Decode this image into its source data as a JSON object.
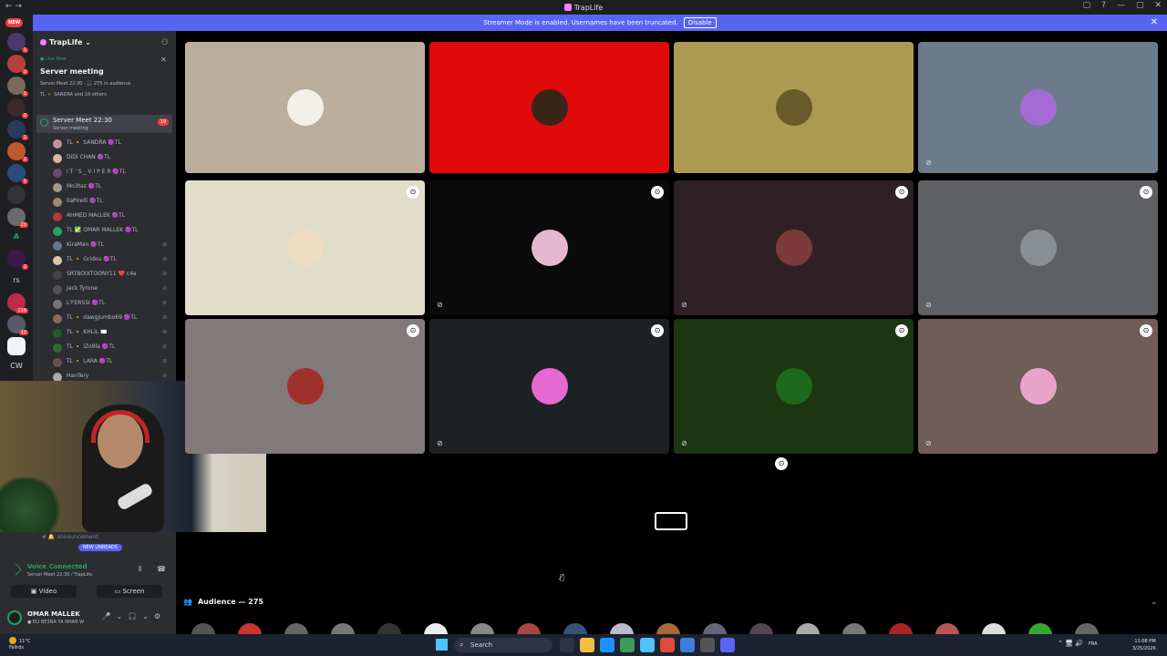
{
  "window": {
    "title": "TrapLife",
    "nav": "← →",
    "controls": [
      "▢",
      "?",
      "—",
      "▢",
      "✕"
    ]
  },
  "banner": {
    "text": "Streamer Mode is enabled. Usernames have been truncated.",
    "disable_label": "Disable",
    "close": "✕"
  },
  "rail": {
    "new_label": "NEW",
    "text_servers": [
      "A",
      "rs",
      "CW"
    ],
    "badges": [
      "1",
      "2",
      "1",
      "2",
      "1",
      "2",
      "1",
      "21",
      "2",
      "116",
      "12"
    ]
  },
  "sidebar": {
    "server_name": "TrapLife",
    "server_chevron": "⌄",
    "live_label": "● Live Now",
    "event_title": "Server meeting",
    "event_meta": "Server Meet 22:30 · 🎧 275 in audience",
    "event_who": "TL 🔸 SANDRA and 16 others",
    "stage_channel": {
      "name": "Server Meet 22:30",
      "topic": "Server meeting",
      "count": "19"
    },
    "members": [
      {
        "name": "TL 🔸 SANDRA  🟣TL",
        "color": "#c98fa0",
        "muted": false
      },
      {
        "name": "DiDi CHAN  🟣TL",
        "color": "#d9b4a8",
        "muted": false
      },
      {
        "name": "I T ' S _ V I P E R  🟣TL",
        "color": "#6a4b6b",
        "muted": false
      },
      {
        "name": "Mo3taz  🟣TL",
        "color": "#a49a8a",
        "muted": false
      },
      {
        "name": "llaPirelli  🟣TL",
        "color": "#9c8b7a",
        "muted": false
      },
      {
        "name": "AHMED MALLEK  🟣TL",
        "color": "#b33a3a",
        "muted": false
      },
      {
        "name": "TL ✅ OMAR MALLEK  🟣TL",
        "color": "#23a55a",
        "muted": false
      },
      {
        "name": "KiraMan  🟣TL",
        "color": "#607a90",
        "muted": true
      },
      {
        "name": "TL 🔸 Gridou  🟣TL",
        "color": "#d9c9a0",
        "muted": true
      },
      {
        "name": "SRTBOIXTOONY11  ❤️ c4a",
        "color": "#444",
        "muted": true
      },
      {
        "name": "Jack Tyrone",
        "color": "#555",
        "muted": true
      },
      {
        "name": "L'FERSSI  🟣TL",
        "color": "#777",
        "muted": true
      },
      {
        "name": "TL 🔸 dawgjumbo69  🟣TL",
        "color": "#8a6a5a",
        "muted": true
      },
      {
        "name": "TL 🔸 KHLIL ✉️",
        "color": "#1f5c2a",
        "muted": true
      },
      {
        "name": "TL 🔸 iZo9la  🟣TL",
        "color": "#2f6b2f",
        "muted": true
      },
      {
        "name": "TL 🔸 LARA  🟣TL",
        "color": "#6b4f4f",
        "muted": true
      },
      {
        "name": "HanTery",
        "color": "#aaa",
        "muted": true
      }
    ]
  },
  "bottom_panel": {
    "channel_announcement": "announcement",
    "new_unreads": "NEW UNREADS",
    "voice_connected": "Voice Connected",
    "voice_sub": "Server Meet 22:30 / TrapLife",
    "video_label": "Video",
    "screen_label": "Screen",
    "user_name": "OMAR MALLEK",
    "user_status": "● ELI BE3NA YA NHAR W",
    "noise_icon": "⦀",
    "disconnect_icon": "☎",
    "user_controls": "🎤⌄🎧⌄⚙"
  },
  "tiles": [
    {
      "bg": "#bcae9c",
      "avatar": "#f3f0ea",
      "muted": false,
      "pinned": false
    },
    {
      "bg": "#e00a0a",
      "avatar": "#3a2418",
      "muted": false,
      "pinned": false
    },
    {
      "bg": "#ad9a52",
      "avatar": "#6a5a2a",
      "muted": false,
      "pinned": false
    },
    {
      "bg": "#6c7b89",
      "avatar": "#a26cd4",
      "muted": true,
      "pinned": false
    },
    {
      "bg": "#e0ddca",
      "avatar": "#f0dcc2",
      "muted": true,
      "pinned": true
    },
    {
      "bg": "#0a0a0a",
      "avatar": "#e6b8d0",
      "muted": true,
      "pinned": true
    },
    {
      "bg": "#2f2026",
      "avatar": "#7c3a3a",
      "muted": true,
      "pinned": true
    },
    {
      "bg": "#5e6064",
      "avatar": "#8a8f94",
      "muted": true,
      "pinned": true
    },
    {
      "bg": "#82797b",
      "avatar": "#a0302c",
      "muted": false,
      "pinned": true
    },
    {
      "bg": "#1e2123",
      "avatar": "#e46ad2",
      "muted": true,
      "pinned": true
    },
    {
      "bg": "#1d3510",
      "avatar": "#1e6a1a",
      "muted": true,
      "pinned": true
    },
    {
      "bg": "#6f5d58",
      "avatar": "#e8a4c8",
      "muted": true,
      "pinned": true
    }
  ],
  "big_tile": {
    "muted": true,
    "pinned": true
  },
  "audience": {
    "label": "Audience — 275",
    "chevron": "⌄",
    "avatar_colors": [
      "#555",
      "#c33",
      "#666",
      "#777",
      "#333",
      "#eee",
      "#888",
      "#a44",
      "#357",
      "#bbc",
      "#a63",
      "#667",
      "#545",
      "#aaa",
      "#777",
      "#a22",
      "#b55",
      "#ddd",
      "#3a3",
      "#666"
    ]
  },
  "taskbar": {
    "weather_temp": "11°C",
    "weather_desc": "Fallrds",
    "search_placeholder": "Search",
    "apps": [
      "#2b3344",
      "#f0c040",
      "#1e90ff",
      "#3a9b5a",
      "#4cc2ff",
      "#e04a3a",
      "#3c7dd9",
      "#555",
      "#5865f2"
    ],
    "tray": "⌃  🖥  🔊",
    "lang": "FRA",
    "time": "11:08 PM",
    "date": "3/25/2026"
  },
  "colors": {
    "accent": "#5865f2",
    "online": "#23a55a",
    "danger": "#f23f42"
  }
}
